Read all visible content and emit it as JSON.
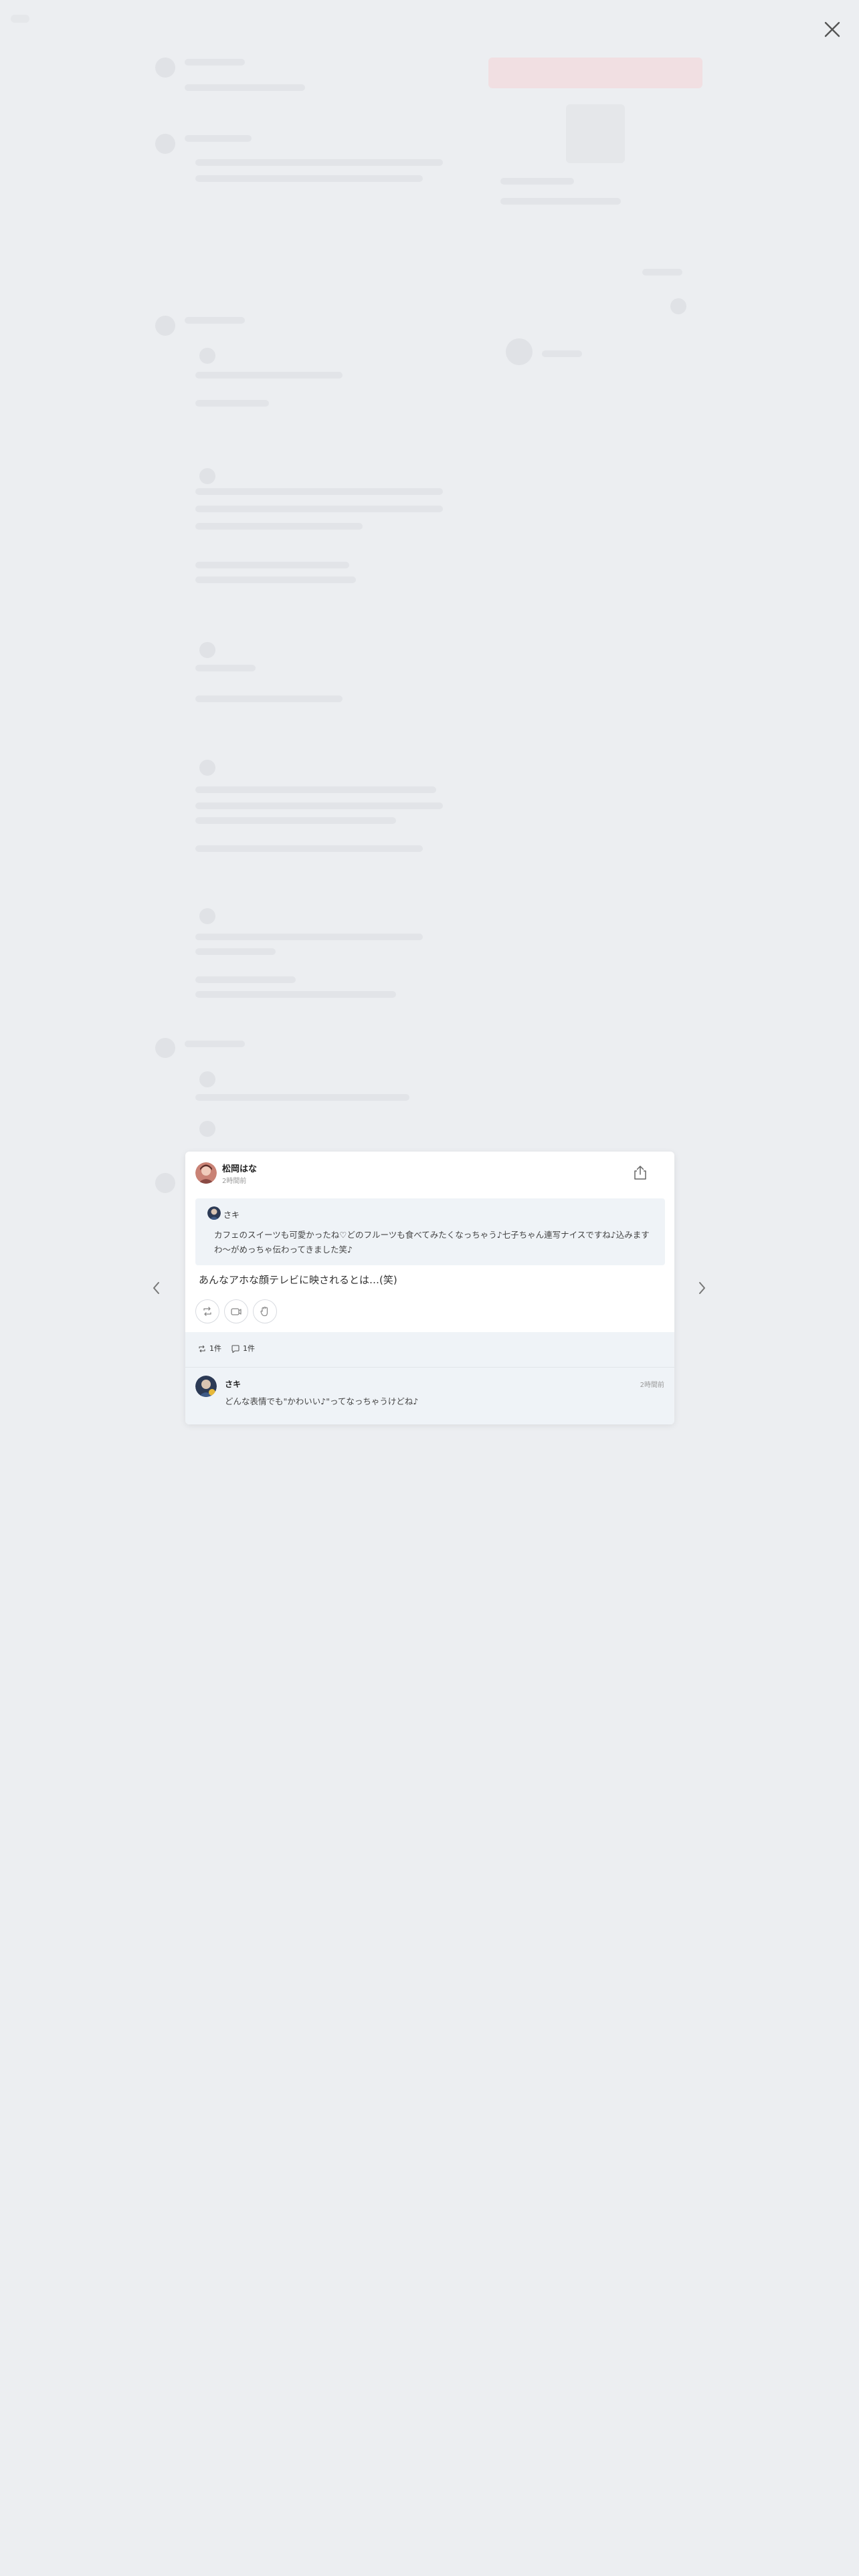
{
  "modal": {
    "author": {
      "name": "松岡はな",
      "time": "2時間前"
    },
    "quote": {
      "author": "さキ",
      "text": "カフェのスイーツも可愛かったね♡どのフルーツも食べてみたくなっちゃう♪七子ちゃん連写ナイスですね♪込みますわ〜がめっちゃ伝わってきました笑♪"
    },
    "main_text": "あんなアホな顔テレビに映されるとは…(笑)",
    "actions": [
      "repost-icon",
      "gift-icon",
      "clap-icon"
    ],
    "stats": {
      "reposts": "1件",
      "comments": "1件"
    },
    "comment": {
      "author": "さキ",
      "time": "2時間前",
      "text": "どんな表情でも\"かわいい♪\"ってなっちゃうけどね♪"
    }
  },
  "colors": {
    "background": "#eceef1",
    "card": "#ffffff",
    "quote_bg": "#eff3f7"
  }
}
